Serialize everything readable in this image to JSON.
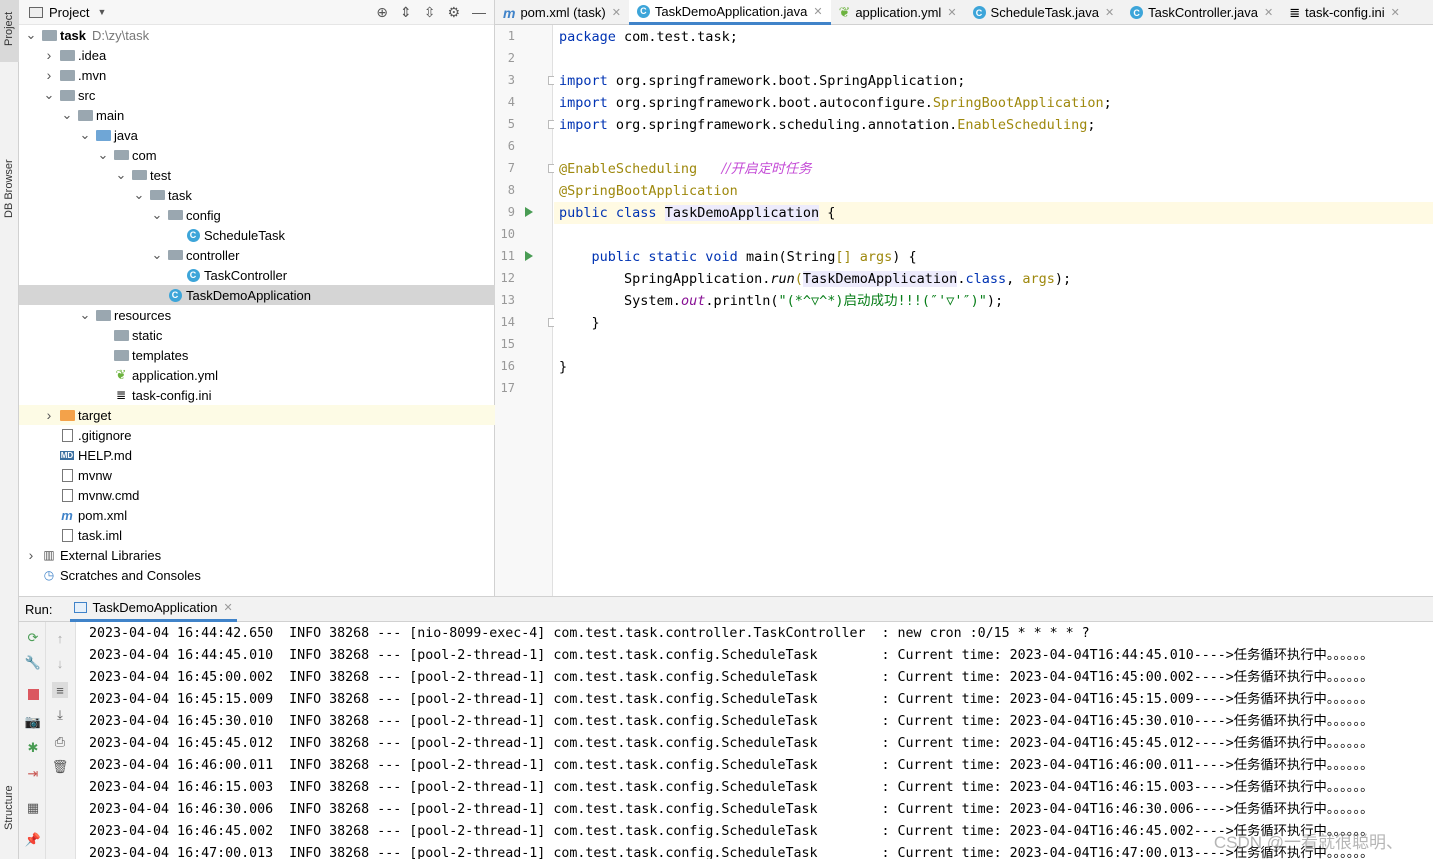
{
  "left_strip": {
    "project_tab": "Project",
    "db_tab": "DB Browser",
    "structure_tab": "Structure"
  },
  "project_panel": {
    "title": "Project",
    "tree": [
      {
        "label": "task",
        "path": "D:\\zy\\task",
        "depth": 0,
        "arrow": "open",
        "icon": "folder"
      },
      {
        "label": ".idea",
        "depth": 1,
        "arrow": "closed",
        "icon": "folder"
      },
      {
        "label": ".mvn",
        "depth": 1,
        "arrow": "closed",
        "icon": "folder"
      },
      {
        "label": "src",
        "depth": 1,
        "arrow": "open",
        "icon": "folder"
      },
      {
        "label": "main",
        "depth": 2,
        "arrow": "open",
        "icon": "folder"
      },
      {
        "label": "java",
        "depth": 3,
        "arrow": "open",
        "icon": "folder-blue"
      },
      {
        "label": "com",
        "depth": 4,
        "arrow": "open",
        "icon": "package"
      },
      {
        "label": "test",
        "depth": 5,
        "arrow": "open",
        "icon": "package"
      },
      {
        "label": "task",
        "depth": 6,
        "arrow": "open",
        "icon": "package"
      },
      {
        "label": "config",
        "depth": 7,
        "arrow": "open",
        "icon": "package"
      },
      {
        "label": "ScheduleTask",
        "depth": 8,
        "arrow": "none",
        "icon": "class"
      },
      {
        "label": "controller",
        "depth": 7,
        "arrow": "open",
        "icon": "package"
      },
      {
        "label": "TaskController",
        "depth": 8,
        "arrow": "none",
        "icon": "class"
      },
      {
        "label": "TaskDemoApplication",
        "depth": 7,
        "arrow": "none",
        "icon": "class",
        "selected": true
      },
      {
        "label": "resources",
        "depth": 3,
        "arrow": "open",
        "icon": "folder-res"
      },
      {
        "label": "static",
        "depth": 4,
        "arrow": "none",
        "icon": "folder"
      },
      {
        "label": "templates",
        "depth": 4,
        "arrow": "none",
        "icon": "folder"
      },
      {
        "label": "application.yml",
        "depth": 4,
        "arrow": "none",
        "icon": "spring"
      },
      {
        "label": "task-config.ini",
        "depth": 4,
        "arrow": "none",
        "icon": "text"
      },
      {
        "label": "target",
        "depth": 1,
        "arrow": "closed",
        "icon": "folder-orange",
        "highlight": true
      },
      {
        "label": ".gitignore",
        "depth": 1,
        "arrow": "none",
        "icon": "file"
      },
      {
        "label": "HELP.md",
        "depth": 1,
        "arrow": "none",
        "icon": "md"
      },
      {
        "label": "mvnw",
        "depth": 1,
        "arrow": "none",
        "icon": "file"
      },
      {
        "label": "mvnw.cmd",
        "depth": 1,
        "arrow": "none",
        "icon": "file"
      },
      {
        "label": "pom.xml",
        "depth": 1,
        "arrow": "none",
        "icon": "maven"
      },
      {
        "label": "task.iml",
        "depth": 1,
        "arrow": "none",
        "icon": "file"
      },
      {
        "label": "External Libraries",
        "depth": 0,
        "arrow": "closed",
        "icon": "libs"
      },
      {
        "label": "Scratches and Consoles",
        "depth": 0,
        "arrow": "none",
        "icon": "scratch"
      }
    ]
  },
  "editor_tabs": [
    {
      "label": "pom.xml (task)",
      "icon": "m",
      "active": false
    },
    {
      "label": "TaskDemoApplication.java",
      "icon": "c",
      "active": true
    },
    {
      "label": "application.yml",
      "icon": "spring",
      "active": false
    },
    {
      "label": "ScheduleTask.java",
      "icon": "c",
      "active": false
    },
    {
      "label": "TaskController.java",
      "icon": "c",
      "active": false
    },
    {
      "label": "task-config.ini",
      "icon": "text",
      "active": false
    }
  ],
  "editor": {
    "line_numbers": [
      "1",
      "2",
      "3",
      "4",
      "5",
      "6",
      "7",
      "8",
      "9",
      "10",
      "11",
      "12",
      "13",
      "14",
      "15",
      "16",
      "17"
    ],
    "code": {
      "l1_kw": "package",
      "l1_rest": " com.test.task;",
      "l3_kw": "import",
      "l3_rest": " org.springframework.boot.SpringApplication;",
      "l4_kw": "import",
      "l4_rest": " org.springframework.boot.autoconfigure.",
      "l4_ann": "SpringBootApplication",
      "l4_end": ";",
      "l5_kw": "import",
      "l5_rest": " org.springframework.scheduling.annotation.",
      "l5_ann": "EnableScheduling",
      "l5_end": ";",
      "l7_ann": "@EnableScheduling",
      "l7_comment": "//开启定时任务",
      "l8_ann": "@SpringBootApplication",
      "l9_kw": "public class",
      "l9_name": "TaskDemoApplication",
      "l9_end": " {",
      "l11_kw": "public static void",
      "l11_rest": " main(String",
      "l11_br": "[]",
      "l11_args": " args",
      "l11_end": ") {",
      "l12_a": "SpringApplication.",
      "l12_run": "run",
      "l12_p": "(",
      "l12_cls": "TaskDemoApplication",
      "l12_dot": ".",
      "l12_kwclass": "class",
      "l12_comma": ", ",
      "l12_args": "args",
      "l12_end": ");",
      "l13_a": "System.",
      "l13_out": "out",
      "l13_b": ".println(",
      "l13_str": "\"(*^▽^*)启动成功!!!(″'▽'″)\"",
      "l13_end": ");",
      "l14": "}",
      "l16": "}"
    }
  },
  "run_panel": {
    "label": "Run:",
    "tab": "TaskDemoApplication",
    "log_lines": [
      "2023-04-04 16:44:42.650  INFO 38268 --- [nio-8099-exec-4] com.test.task.controller.TaskController  : new cron :0/15 * * * * ?",
      "2023-04-04 16:44:45.010  INFO 38268 --- [pool-2-thread-1] com.test.task.config.ScheduleTask        : Current time: 2023-04-04T16:44:45.010---->任务循环执行中。。。。。。",
      "2023-04-04 16:45:00.002  INFO 38268 --- [pool-2-thread-1] com.test.task.config.ScheduleTask        : Current time: 2023-04-04T16:45:00.002---->任务循环执行中。。。。。。",
      "2023-04-04 16:45:15.009  INFO 38268 --- [pool-2-thread-1] com.test.task.config.ScheduleTask        : Current time: 2023-04-04T16:45:15.009---->任务循环执行中。。。。。。",
      "2023-04-04 16:45:30.010  INFO 38268 --- [pool-2-thread-1] com.test.task.config.ScheduleTask        : Current time: 2023-04-04T16:45:30.010---->任务循环执行中。。。。。。",
      "2023-04-04 16:45:45.012  INFO 38268 --- [pool-2-thread-1] com.test.task.config.ScheduleTask        : Current time: 2023-04-04T16:45:45.012---->任务循环执行中。。。。。。",
      "2023-04-04 16:46:00.011  INFO 38268 --- [pool-2-thread-1] com.test.task.config.ScheduleTask        : Current time: 2023-04-04T16:46:00.011---->任务循环执行中。。。。。。",
      "2023-04-04 16:46:15.003  INFO 38268 --- [pool-2-thread-1] com.test.task.config.ScheduleTask        : Current time: 2023-04-04T16:46:15.003---->任务循环执行中。。。。。。",
      "2023-04-04 16:46:30.006  INFO 38268 --- [pool-2-thread-1] com.test.task.config.ScheduleTask        : Current time: 2023-04-04T16:46:30.006---->任务循环执行中。。。。。。",
      "2023-04-04 16:46:45.002  INFO 38268 --- [pool-2-thread-1] com.test.task.config.ScheduleTask        : Current time: 2023-04-04T16:46:45.002---->任务循环执行中。。。。。。",
      "2023-04-04 16:47:00.013  INFO 38268 --- [pool-2-thread-1] com.test.task.config.ScheduleTask        : Current time: 2023-04-04T16:47:00.013---->任务循环执行中。。。。。。"
    ]
  },
  "watermark": "CSDN @一看就很聪明、"
}
